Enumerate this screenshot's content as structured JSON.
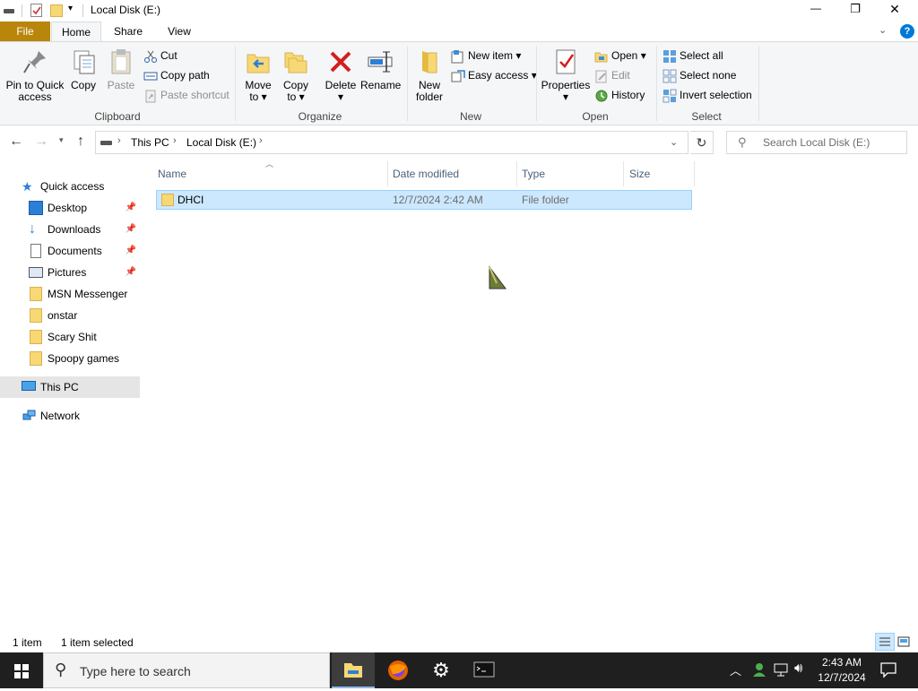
{
  "window": {
    "title": "Local Disk (E:)",
    "min_glyph": "—",
    "max_glyph": "❐",
    "close_glyph": "✕"
  },
  "ribbon_tabs": {
    "file": "File",
    "home": "Home",
    "share": "Share",
    "view": "View"
  },
  "clipboard": {
    "pin_label": "Pin to Quick\naccess",
    "copy_label": "Copy",
    "paste_label": "Paste",
    "cut_label": "Cut",
    "copy_path_label": "Copy path",
    "paste_shortcut_label": "Paste shortcut",
    "group_label": "Clipboard"
  },
  "organize": {
    "move_to_label": "Move\nto ▾",
    "copy_to_label": "Copy\nto ▾",
    "delete_label": "Delete\n▾",
    "rename_label": "Rename",
    "group_label": "Organize"
  },
  "new": {
    "new_folder_label": "New\nfolder",
    "new_item_label": "New item ▾",
    "easy_access_label": "Easy access ▾",
    "group_label": "New"
  },
  "open": {
    "properties_label": "Properties\n▾",
    "open_label": "Open ▾",
    "edit_label": "Edit",
    "history_label": "History",
    "group_label": "Open"
  },
  "select": {
    "select_all_label": "Select all",
    "select_none_label": "Select none",
    "invert_selection_label": "Invert selection",
    "group_label": "Select"
  },
  "address": {
    "crumbs": [
      "This PC",
      "Local Disk (E:)"
    ],
    "search_placeholder": "Search Local Disk (E:)"
  },
  "nav": {
    "quick_access": "Quick access",
    "items": [
      {
        "label": "Desktop",
        "pinned": true
      },
      {
        "label": "Downloads",
        "pinned": true
      },
      {
        "label": "Documents",
        "pinned": true
      },
      {
        "label": "Pictures",
        "pinned": true
      },
      {
        "label": "MSN Messenger",
        "pinned": false
      },
      {
        "label": "onstar",
        "pinned": false
      },
      {
        "label": "Scary Shit",
        "pinned": false
      },
      {
        "label": "Spoopy games",
        "pinned": false
      }
    ],
    "this_pc": "This PC",
    "network": "Network"
  },
  "columns": {
    "name": "Name",
    "date_modified": "Date modified",
    "type": "Type",
    "size": "Size"
  },
  "files": [
    {
      "name": "DHCI",
      "date_modified": "12/7/2024 2:42 AM",
      "type": "File folder",
      "size": ""
    }
  ],
  "status": {
    "count": "1 item",
    "selected": "1 item selected"
  },
  "taskbar": {
    "search_placeholder": "Type here to search",
    "time": "2:43 AM",
    "date": "12/7/2024"
  },
  "colors": {
    "file_tab": "#b8860b",
    "accent": "#0078d7",
    "selection": "#cce8ff",
    "folder": "#f8d775"
  }
}
